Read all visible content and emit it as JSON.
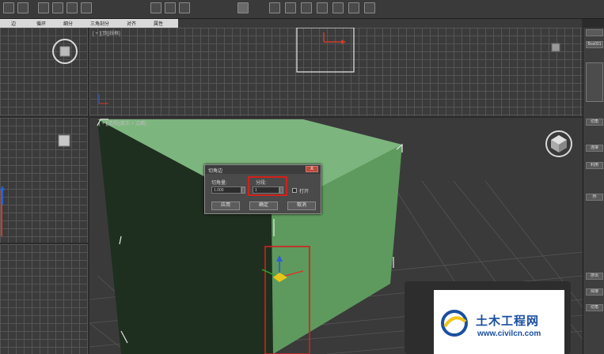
{
  "ribbon": {
    "items": [
      "边",
      "循环",
      "细分",
      "三角剖分",
      "对齐",
      "属性"
    ]
  },
  "viewports": {
    "top_label": "[ + ][顶][线框]",
    "persp_label": "[ + ][透视][真实 + 边面]"
  },
  "dialog": {
    "title": "切角边",
    "close_label": "X",
    "chamfer_amount_label": "切角量:",
    "chamfer_amount_value": "1.000",
    "segments_label": "分段:",
    "segments_value": "1",
    "open_label": "打开",
    "apply_label": "应用",
    "ok_label": "确定",
    "cancel_label": "取消"
  },
  "command_panel": {
    "items": [
      "Box001",
      "切角",
      "连接",
      "利用",
      "桥",
      "挤出",
      "焊接",
      "切角"
    ]
  },
  "watermark": {
    "title": "土木工程网",
    "url": "www.civilcn.com"
  },
  "colors": {
    "box_top": "#7db57e",
    "box_side": "#5e9a5e",
    "box_dark": "#1f2f1f",
    "highlight": "#d2211c",
    "axis_x": "#d23a2a",
    "axis_y": "#2ea72e",
    "axis_z": "#2e5fd6",
    "gizmo": "#e6c619"
  }
}
